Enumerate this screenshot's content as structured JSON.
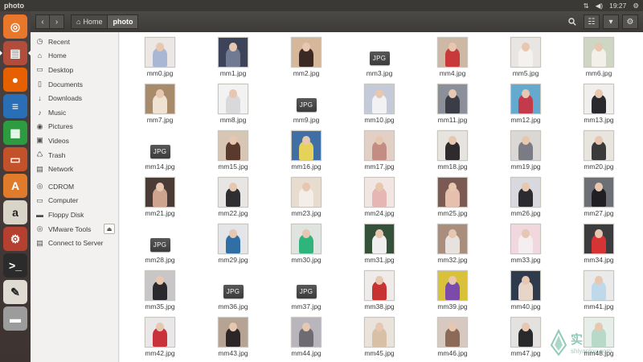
{
  "window": {
    "title": "photo"
  },
  "panel": {
    "time": "19:27",
    "icons": [
      "network-icon",
      "sound-icon",
      "power-gear-icon"
    ]
  },
  "header": {
    "breadcrumbs": [
      {
        "label": "Home",
        "icon": "home-icon"
      },
      {
        "label": "photo"
      }
    ]
  },
  "launcher": [
    {
      "name": "ubuntu-dash-icon",
      "color": "#e8762b",
      "glyph": "◎"
    },
    {
      "name": "files-icon",
      "color": "#b24d3b",
      "glyph": "▤",
      "active": true
    },
    {
      "name": "firefox-icon",
      "color": "#e66000",
      "glyph": "●"
    },
    {
      "name": "writer-icon",
      "color": "#2a6fb5",
      "glyph": "≡"
    },
    {
      "name": "calc-icon",
      "color": "#2d9b3f",
      "glyph": "▦"
    },
    {
      "name": "impress-icon",
      "color": "#c3512a",
      "glyph": "▭"
    },
    {
      "name": "software-center-icon",
      "color": "#e07b2c",
      "glyph": "A"
    },
    {
      "name": "amazon-icon",
      "color": "#d9d4c8",
      "glyph": "a"
    },
    {
      "name": "settings-icon",
      "color": "#b6402f",
      "glyph": "⚙"
    },
    {
      "name": "terminal-icon",
      "color": "#2b2b2b",
      "glyph": ">_"
    },
    {
      "name": "text-editor-icon",
      "color": "#dfdbd2",
      "glyph": "✎"
    },
    {
      "name": "disks-icon",
      "color": "#9c9c9c",
      "glyph": "▬"
    }
  ],
  "sidebar": {
    "places": [
      {
        "label": "Recent",
        "icon": "clock-icon",
        "glyph": "◷"
      },
      {
        "label": "Home",
        "icon": "home-icon",
        "glyph": "⌂"
      },
      {
        "label": "Desktop",
        "icon": "desktop-icon",
        "glyph": "▭"
      },
      {
        "label": "Documents",
        "icon": "documents-icon",
        "glyph": "▯"
      },
      {
        "label": "Downloads",
        "icon": "downloads-icon",
        "glyph": "↓"
      },
      {
        "label": "Music",
        "icon": "music-icon",
        "glyph": "♪"
      },
      {
        "label": "Pictures",
        "icon": "pictures-icon",
        "glyph": "◉"
      },
      {
        "label": "Videos",
        "icon": "videos-icon",
        "glyph": "▣"
      },
      {
        "label": "Trash",
        "icon": "trash-icon",
        "glyph": "♺"
      },
      {
        "label": "Network",
        "icon": "network-icon",
        "glyph": "▤"
      }
    ],
    "devices": [
      {
        "label": "CDROM",
        "icon": "disc-icon",
        "glyph": "◎"
      },
      {
        "label": "Computer",
        "icon": "computer-icon",
        "glyph": "▭"
      },
      {
        "label": "Floppy Disk",
        "icon": "floppy-icon",
        "glyph": "▬"
      },
      {
        "label": "VMware Tools",
        "icon": "disc-icon",
        "glyph": "◎",
        "eject": true
      },
      {
        "label": "Connect to Server",
        "icon": "server-icon",
        "glyph": "▤"
      }
    ]
  },
  "files": [
    {
      "name": "mm0.jpg",
      "t": "p",
      "bg": "#ece7e4",
      "c": "#a9b6d4"
    },
    {
      "name": "mm1.jpg",
      "t": "p",
      "bg": "#3d4358",
      "c": "#707a92"
    },
    {
      "name": "mm2.jpg",
      "t": "p",
      "bg": "#d7b79a",
      "c": "#3b2a24"
    },
    {
      "name": "mm3.jpg",
      "t": "j"
    },
    {
      "name": "mm4.jpg",
      "t": "p",
      "bg": "#cdb8a6",
      "c": "#c83a3a"
    },
    {
      "name": "mm5.jpg",
      "t": "p",
      "bg": "#e9e5e2",
      "c": "#f4f2ef"
    },
    {
      "name": "mm6.jpg",
      "t": "p",
      "bg": "#cfd6c4",
      "c": "#f3f0ea"
    },
    {
      "name": "mm7.jpg",
      "t": "p",
      "bg": "#a88b6b",
      "c": "#efe2d2"
    },
    {
      "name": "mm8.jpg",
      "t": "p",
      "bg": "#f3f2f2",
      "c": "#d9d9db"
    },
    {
      "name": "mm9.jpg",
      "t": "j"
    },
    {
      "name": "mm10.jpg",
      "t": "p",
      "bg": "#c5cad8",
      "c": "#f2f2f4"
    },
    {
      "name": "mm11.jpg",
      "t": "p",
      "bg": "#8a8f99",
      "c": "#3a3d45"
    },
    {
      "name": "mm12.jpg",
      "t": "p",
      "bg": "#66a9cf",
      "c": "#c33b4a"
    },
    {
      "name": "mm13.jpg",
      "t": "p",
      "bg": "#f1eeee",
      "c": "#2a2a2e"
    },
    {
      "name": "mm14.jpg",
      "t": "j"
    },
    {
      "name": "mm15.jpg",
      "t": "p",
      "bg": "#d8c6b5",
      "c": "#5b3a2e"
    },
    {
      "name": "mm16.jpg",
      "t": "p",
      "bg": "#3f6fa5",
      "c": "#e6d25a"
    },
    {
      "name": "mm17.jpg",
      "t": "p",
      "bg": "#e2cfc6",
      "c": "#c48d83"
    },
    {
      "name": "mm18.jpg",
      "t": "p",
      "bg": "#e7e4e0",
      "c": "#2d2b2b"
    },
    {
      "name": "mm19.jpg",
      "t": "p",
      "bg": "#dad7d5",
      "c": "#7b7b84"
    },
    {
      "name": "mm20.jpg",
      "t": "p",
      "bg": "#e8e4de",
      "c": "#3a3a3a"
    },
    {
      "name": "mm21.jpg",
      "t": "p",
      "bg": "#4b3b36",
      "c": "#cfa48e"
    },
    {
      "name": "mm22.jpg",
      "t": "p",
      "bg": "#e8e6e4",
      "c": "#2f2f33"
    },
    {
      "name": "mm23.jpg",
      "t": "p",
      "bg": "#e7dccd",
      "c": "#f3efe8"
    },
    {
      "name": "mm24.jpg",
      "t": "p",
      "bg": "#f2e6e2",
      "c": "#e6b6b4"
    },
    {
      "name": "mm25.jpg",
      "t": "p",
      "bg": "#7a5a52",
      "c": "#e6c0ad"
    },
    {
      "name": "mm26.jpg",
      "t": "p",
      "bg": "#d9d8de",
      "c": "#2b2b30"
    },
    {
      "name": "mm27.jpg",
      "t": "p",
      "bg": "#6d6f77",
      "c": "#1f1f24"
    },
    {
      "name": "mm28.jpg",
      "t": "j"
    },
    {
      "name": "mm29.jpg",
      "t": "p",
      "bg": "#e3e5e9",
      "c": "#2f6fa6"
    },
    {
      "name": "mm30.jpg",
      "t": "p",
      "bg": "#dfe4e1",
      "c": "#2fb57b"
    },
    {
      "name": "mm31.jpg",
      "t": "p",
      "bg": "#36513a",
      "c": "#f0eeee"
    },
    {
      "name": "mm32.jpg",
      "t": "p",
      "bg": "#a98d7d",
      "c": "#e8e2de"
    },
    {
      "name": "mm33.jpg",
      "t": "p",
      "bg": "#f1d8df",
      "c": "#f4eef0"
    },
    {
      "name": "mm34.jpg",
      "t": "p",
      "bg": "#3c3c3f",
      "c": "#d63434"
    },
    {
      "name": "mm35.jpg",
      "t": "p",
      "bg": "#c8c6c6",
      "c": "#2a2a2e"
    },
    {
      "name": "mm36.jpg",
      "t": "j"
    },
    {
      "name": "mm37.jpg",
      "t": "j"
    },
    {
      "name": "mm38.jpg",
      "t": "p",
      "bg": "#efebeb",
      "c": "#c73232"
    },
    {
      "name": "mm39.jpg",
      "t": "p",
      "bg": "#d9c23a",
      "c": "#7c4aa8"
    },
    {
      "name": "mm40.jpg",
      "t": "p",
      "bg": "#2f3a4c",
      "c": "#e7d6c8"
    },
    {
      "name": "mm41.jpg",
      "t": "p",
      "bg": "#eaeaea",
      "c": "#bfd8ea"
    },
    {
      "name": "mm42.jpg",
      "t": "p",
      "bg": "#e9e7e7",
      "c": "#c9323a"
    },
    {
      "name": "mm43.jpg",
      "t": "p",
      "bg": "#b7a393",
      "c": "#2c2626"
    },
    {
      "name": "mm44.jpg",
      "t": "p",
      "bg": "#b8b6bc",
      "c": "#6f6b72"
    },
    {
      "name": "mm45.jpg",
      "t": "p",
      "bg": "#e9e3dc",
      "c": "#d8c0a6"
    },
    {
      "name": "mm46.jpg",
      "t": "p",
      "bg": "#d7c9bf",
      "c": "#8b6a58"
    },
    {
      "name": "mm47.jpg",
      "t": "p",
      "bg": "#e4e2e0",
      "c": "#2a2a2c"
    },
    {
      "name": "mm48.jpg",
      "t": "p",
      "bg": "#e6eee9",
      "c": "#b9d9c8"
    }
  ],
  "watermark": {
    "cn": "实验楼",
    "en": "shiyanlou.com"
  }
}
